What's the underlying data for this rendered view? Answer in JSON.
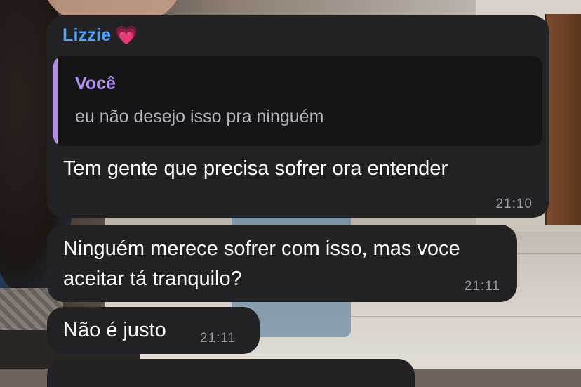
{
  "messages": [
    {
      "sender": "Lizzie",
      "sender_emoji": "💗",
      "reply": {
        "author": "Você",
        "text": "eu não desejo isso pra ninguém"
      },
      "text": "Tem gente que precisa sofrer ora entender",
      "time": "21:10"
    },
    {
      "text": "Ninguém merece sofrer com isso, mas voce aceitar tá tranquilo?",
      "time": "21:11"
    },
    {
      "text": "Não é justo",
      "time": "21:11"
    }
  ],
  "colors": {
    "bubble_bg": "#222225",
    "quote_bg": "#151517",
    "sender_name": "#4aa3ff",
    "reply_accent": "#b48cf2",
    "timestamp": "#9a9aa0"
  },
  "icons": {
    "sender_emoji": "growing-heart-icon"
  }
}
